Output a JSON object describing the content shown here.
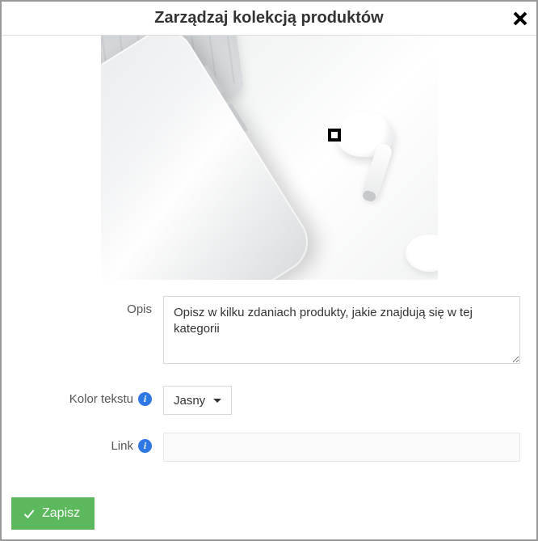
{
  "header": {
    "title": "Zarządzaj kolekcją produktów"
  },
  "form": {
    "description": {
      "label": "Opis",
      "placeholder": "Opisz w kilku zdaniach produkty, jakie znajdują się w tej kategorii",
      "value": ""
    },
    "text_color": {
      "label": "Kolor tekstu",
      "selected": "Jasny"
    },
    "link": {
      "label": "Link",
      "value": ""
    }
  },
  "footer": {
    "save_label": "Zapisz"
  }
}
